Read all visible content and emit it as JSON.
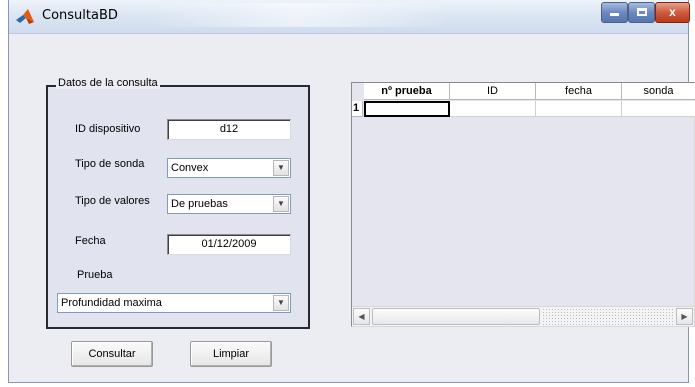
{
  "window": {
    "title": "ConsultaBD",
    "controls": {
      "minimize": "minimize",
      "maximize": "maximize",
      "close": "x"
    }
  },
  "query_group": {
    "legend": "Datos de la consulta",
    "device_id": {
      "label": "ID dispositivo",
      "value": "d12"
    },
    "probe_type": {
      "label": "Tipo de sonda",
      "value": "Convex"
    },
    "value_type": {
      "label": "Tipo de valores",
      "value": "De pruebas"
    },
    "date": {
      "label": "Fecha",
      "value": "01/12/2009"
    },
    "test": {
      "label": "Prueba",
      "value": "Profundidad maxima"
    }
  },
  "buttons": {
    "consult": "Consultar",
    "clear": "Limpiar"
  },
  "results_table": {
    "columns": [
      "nº prueba",
      "ID",
      "fecha",
      "sonda"
    ],
    "rows": [
      {
        "index": "1",
        "cells": [
          "",
          "",
          "",
          ""
        ]
      }
    ]
  },
  "icons": {
    "app": "matlab-icon",
    "dropdown": "chevron-down-icon",
    "scroll_left": "arrow-left-icon",
    "scroll_right": "arrow-right-icon"
  },
  "colors": {
    "window_bg": "#ececf3",
    "group_bg": "#e1e3ef",
    "close_button": "#cd5b3e"
  }
}
